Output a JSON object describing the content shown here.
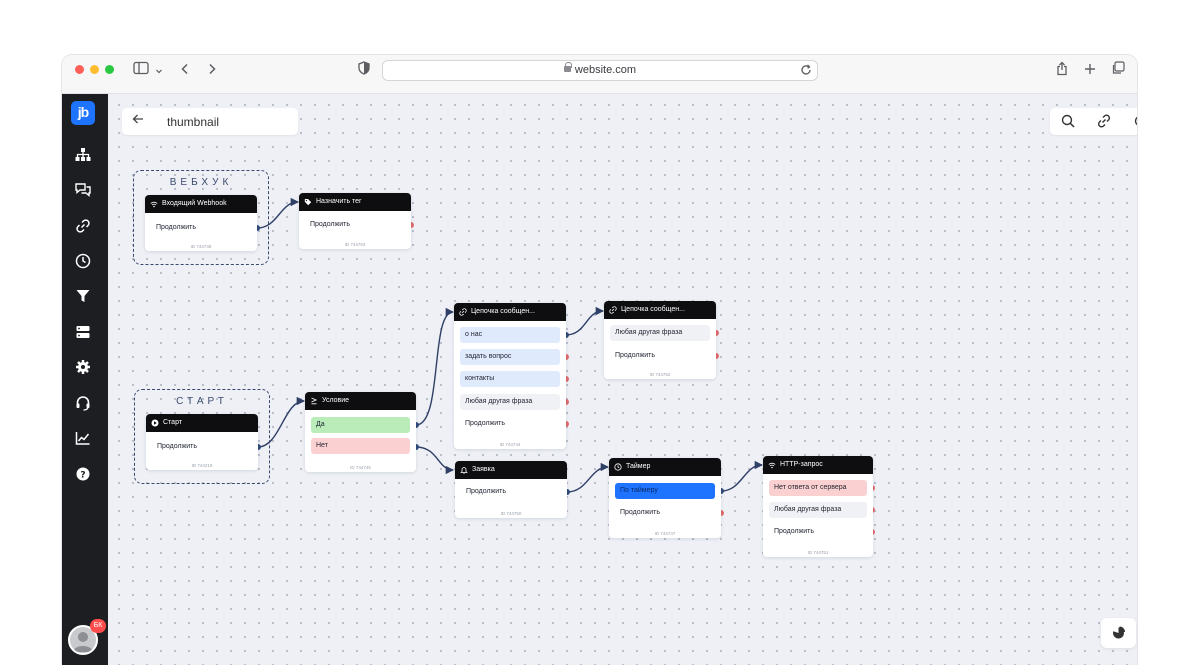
{
  "browser": {
    "url": "website.com"
  },
  "colors": {
    "accent": "#1e73ff",
    "wire": "#2f3f66",
    "port_out": "#2f4a7a",
    "port_free": "#e06b6b",
    "option_blue": "#dfeafd",
    "option_green": "#b9ecb9",
    "option_red": "#fbd0d0",
    "option_gray": "#f0f1f4",
    "option_selected": "#1e73ff"
  },
  "sidebar": {
    "logo": "jb",
    "items": [
      {
        "icon": "sitemap-icon"
      },
      {
        "icon": "chat-icon"
      },
      {
        "icon": "link-icon"
      },
      {
        "icon": "clock-icon"
      },
      {
        "icon": "filter-icon"
      },
      {
        "icon": "server-icon"
      },
      {
        "icon": "gear-icon"
      },
      {
        "icon": "headset-icon"
      },
      {
        "icon": "chart-icon"
      },
      {
        "icon": "help-icon"
      }
    ],
    "avatar_badge": "БК"
  },
  "canvas": {
    "title": "thumbnail",
    "tools": [
      "search-icon",
      "link-icon",
      "settings-icon"
    ]
  },
  "groups": {
    "webhook": "ВЕБХУК",
    "start": "СТАРТ"
  },
  "nodes": {
    "webhook": {
      "title": "Входящий Webhook",
      "opt0": "Продолжить",
      "id": "ID 744748"
    },
    "tag": {
      "title": "Назначить тег",
      "opt0": "Продолжить",
      "id": "ID 744753"
    },
    "start": {
      "title": "Старт",
      "opt0": "Продолжить",
      "id": "ID 744219"
    },
    "cond": {
      "title": "Условие",
      "opt0": "Да",
      "opt1": "Нет",
      "id": "ID 744745"
    },
    "chain1": {
      "title": "Цепочка сообщен...",
      "opt0": "о нас",
      "opt1": "задать вопрос",
      "opt2": "контакты",
      "opt3": "Любая другая фраза",
      "opt4": "Продолжить",
      "id": "ID 744744"
    },
    "chain2": {
      "title": "Цепочка сообщен...",
      "opt0": "Любая другая фраза",
      "opt1": "Продолжить",
      "id": "ID 744752"
    },
    "zayavka": {
      "title": "Заявка",
      "opt0": "Продолжить",
      "id": "ID 744750"
    },
    "timer": {
      "title": "Таймер",
      "opt0": "По таймеру",
      "opt1": "Продолжить",
      "id": "ID 744747"
    },
    "http": {
      "title": "HTTP-запрос",
      "opt0": "Нет ответа от сервера",
      "opt1": "Любая другая фраза",
      "opt2": "Продолжить",
      "id": "ID 744751"
    }
  }
}
